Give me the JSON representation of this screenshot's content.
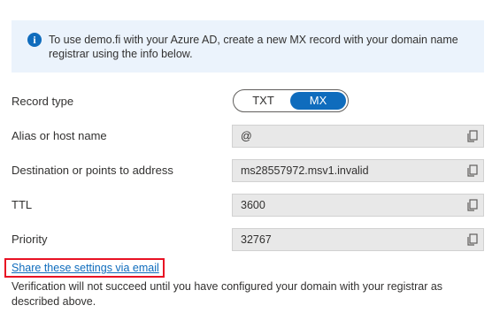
{
  "info": {
    "icon": "info-icon",
    "glyph": "i",
    "text": "To use demo.fi with your Azure AD, create a new MX record with your domain name registrar using the info below."
  },
  "record_type": {
    "label": "Record type",
    "options": [
      "TXT",
      "MX"
    ],
    "selected": "MX"
  },
  "alias": {
    "label": "Alias or host name",
    "value": "@"
  },
  "destination": {
    "label": "Destination or points to address",
    "value": "ms28557972.msv1.invalid"
  },
  "ttl": {
    "label": "TTL",
    "value": "3600"
  },
  "priority": {
    "label": "Priority",
    "value": "32767"
  },
  "share_link": {
    "label": "Share these settings via email"
  },
  "verification_note": "Verification will not succeed until you have configured your domain with your registrar as described above.",
  "colors": {
    "accent": "#0f6cbd",
    "info_bg": "#ebf3fc",
    "highlight": "#e81123",
    "field_bg": "#e8e8e8"
  }
}
